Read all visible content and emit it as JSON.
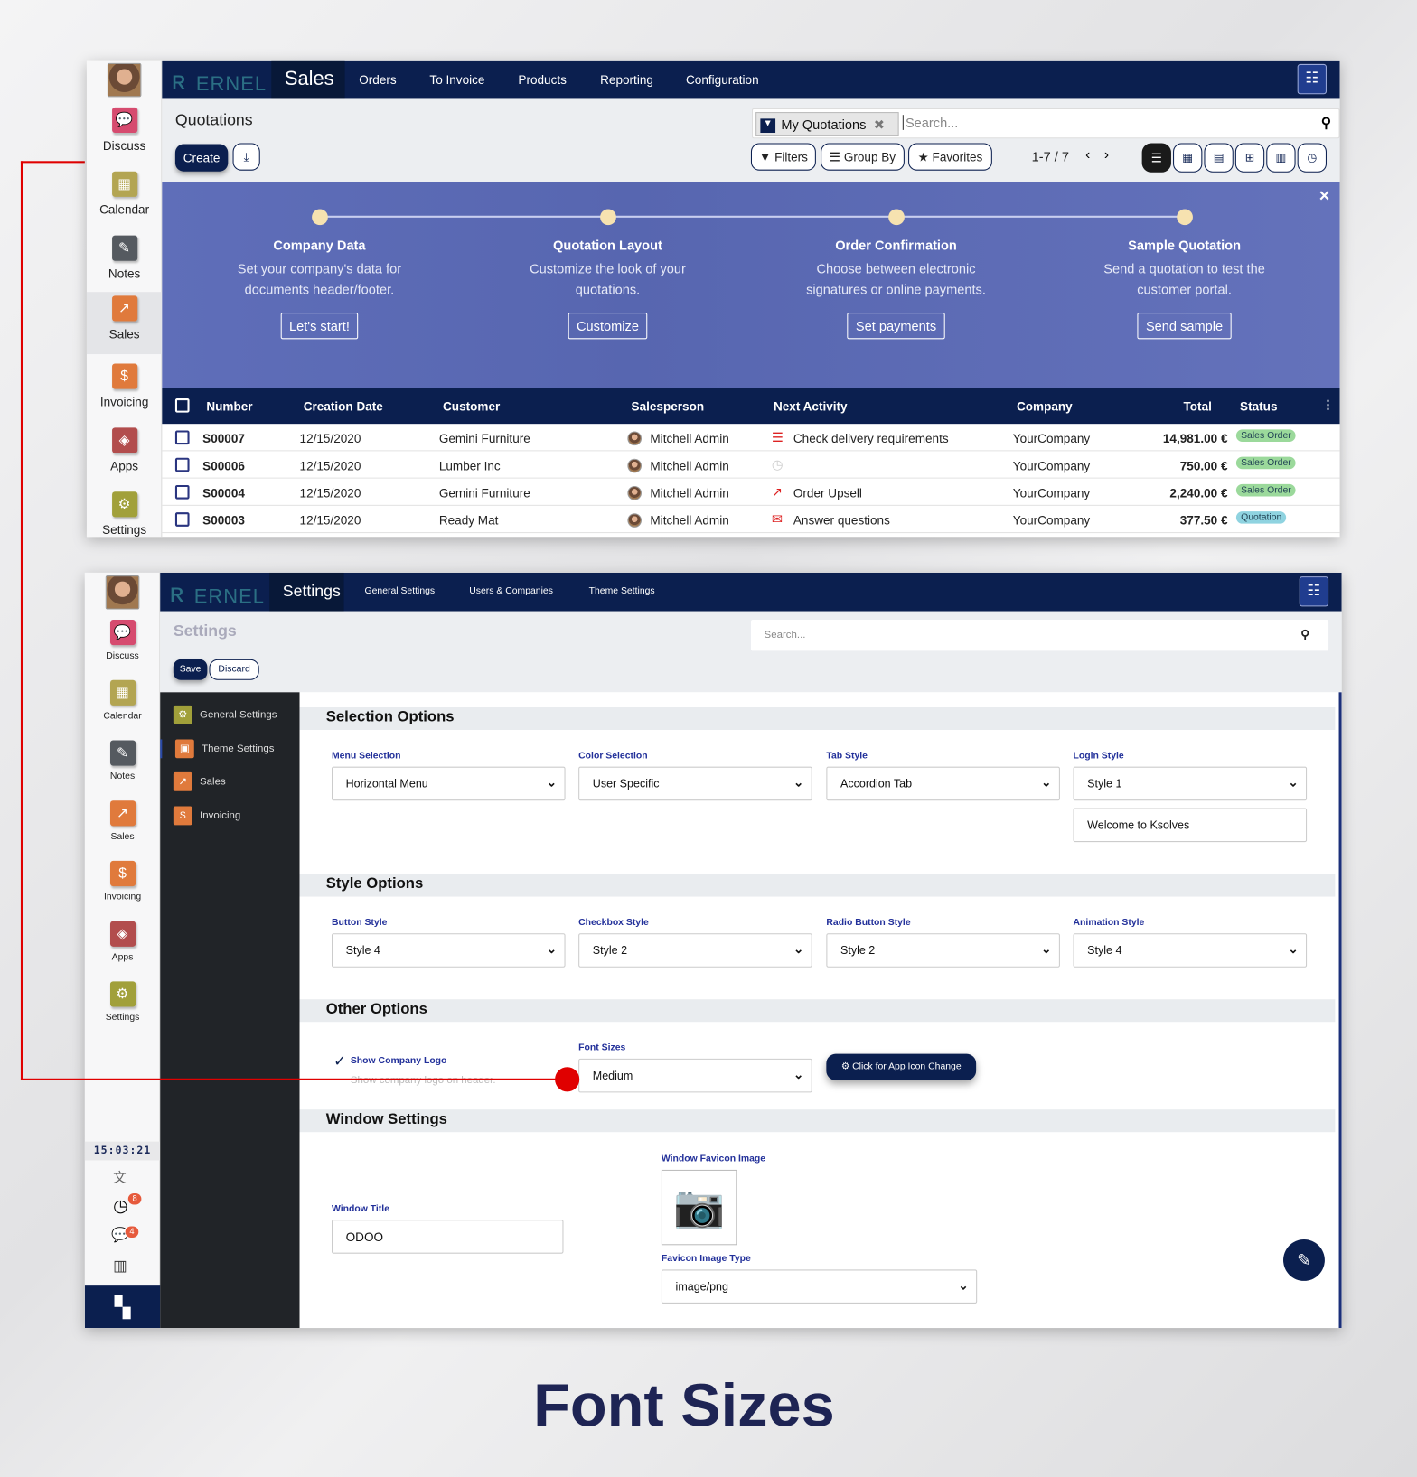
{
  "panel1": {
    "sidebar": [
      {
        "label": "Discuss",
        "icon": "chat-icon",
        "color": "#d64b6f",
        "glyph": "💬"
      },
      {
        "label": "Calendar",
        "icon": "calendar-icon",
        "color": "#b3a552",
        "glyph": "▦"
      },
      {
        "label": "Notes",
        "icon": "notes-icon",
        "color": "#555a60",
        "glyph": "✎"
      },
      {
        "label": "Sales",
        "icon": "sales-chart-icon",
        "color": "#e07a3c",
        "glyph": "↗"
      },
      {
        "label": "Invoicing",
        "icon": "invoice-icon",
        "color": "#e07a3c",
        "glyph": "$"
      },
      {
        "label": "Apps",
        "icon": "apps-icon",
        "color": "#b24d4d",
        "glyph": "◈"
      },
      {
        "label": "Settings",
        "icon": "gear-icon",
        "color": "#a1a03a",
        "glyph": "⚙"
      }
    ],
    "logo": "ERNEL",
    "app_title": "Sales",
    "menu": [
      "Orders",
      "To Invoice",
      "Products",
      "Reporting",
      "Configuration"
    ],
    "page_title": "Quotations",
    "create_label": "Create",
    "search": {
      "facet": "My Quotations",
      "placeholder": "Search..."
    },
    "filters": "Filters",
    "group_by": "Group By",
    "favorites": "Favorites",
    "pager": "1-7 / 7",
    "banner": {
      "steps": [
        {
          "title": "Company Data",
          "text": "Set your company's data for documents header/footer.",
          "button": "Let's start!"
        },
        {
          "title": "Quotation Layout",
          "text": "Customize the look of your quotations.",
          "button": "Customize"
        },
        {
          "title": "Order Confirmation",
          "text": "Choose between electronic signatures or online payments.",
          "button": "Set payments"
        },
        {
          "title": "Sample Quotation",
          "text": "Send a quotation to test the customer portal.",
          "button": "Send sample"
        }
      ]
    },
    "table": {
      "headers": [
        "Number",
        "Creation Date",
        "Customer",
        "Salesperson",
        "Next Activity",
        "Company",
        "Total",
        "Status"
      ],
      "rows": [
        {
          "number": "S00007",
          "date": "12/15/2020",
          "customer": "Gemini Furniture",
          "salesperson": "Mitchell Admin",
          "activity": "Check delivery requirements",
          "activity_icon": "checklist-icon",
          "company": "YourCompany",
          "total": "14,981.00 €",
          "status": "Sales Order"
        },
        {
          "number": "S00006",
          "date": "12/15/2020",
          "customer": "Lumber Inc",
          "salesperson": "Mitchell Admin",
          "activity": "",
          "activity_icon": "clock-icon",
          "company": "YourCompany",
          "total": "750.00 €",
          "status": "Sales Order"
        },
        {
          "number": "S00004",
          "date": "12/15/2020",
          "customer": "Gemini Furniture",
          "salesperson": "Mitchell Admin",
          "activity": "Order Upsell",
          "activity_icon": "upsell-chart-icon",
          "company": "YourCompany",
          "total": "2,240.00 €",
          "status": "Sales Order"
        },
        {
          "number": "S00003",
          "date": "12/15/2020",
          "customer": "Ready Mat",
          "salesperson": "Mitchell Admin",
          "activity": "Answer questions",
          "activity_icon": "email-icon",
          "company": "YourCompany",
          "total": "377.50 €",
          "status": "Quotation"
        }
      ]
    }
  },
  "panel2": {
    "sidebar": [
      {
        "label": "Discuss"
      },
      {
        "label": "Calendar"
      },
      {
        "label": "Notes"
      },
      {
        "label": "Sales"
      },
      {
        "label": "Invoicing"
      },
      {
        "label": "Apps"
      },
      {
        "label": "Settings"
      }
    ],
    "app_title": "Settings",
    "menu": [
      "General Settings",
      "Users & Companies",
      "Theme Settings"
    ],
    "page_title": "Settings",
    "search_placeholder": "Search...",
    "save": "Save",
    "discard": "Discard",
    "settings_menu": [
      "General Settings",
      "Theme Settings",
      "Sales",
      "Invoicing"
    ],
    "clock": "15:03:21",
    "activity_badge": "8",
    "message_badge": "4",
    "sections": {
      "selection": {
        "title": "Selection Options",
        "menu_label": "Menu Selection",
        "menu_value": "Horizontal Menu",
        "color_label": "Color Selection",
        "color_value": "User Specific",
        "tab_label": "Tab Style",
        "tab_value": "Accordion Tab",
        "login_label": "Login Style",
        "login_value": "Style 1",
        "login_text": "Welcome to Ksolves"
      },
      "style": {
        "title": "Style Options",
        "button_label": "Button Style",
        "button_value": "Style 4",
        "checkbox_label": "Checkbox Style",
        "checkbox_value": "Style 2",
        "radio_label": "Radio Button Style",
        "radio_value": "Style 2",
        "animation_label": "Animation Style",
        "animation_value": "Style 4"
      },
      "other": {
        "title": "Other Options",
        "logo_label": "Show Company Logo",
        "logo_help": "Show company logo on header.",
        "logo_checked": true,
        "font_label": "Font Sizes",
        "font_value": "Medium",
        "app_icon_button": "Click for App Icon Change"
      },
      "window": {
        "title": "Window Settings",
        "title_label": "Window Title",
        "title_value": "ODOO",
        "favicon_label": "Window Favicon Image",
        "favicon_type_label": "Favicon Image Type",
        "favicon_type_value": "image/png"
      }
    }
  },
  "caption": "Font Sizes",
  "colors": {
    "navy": "#0b1f4f",
    "banner": "#5c6bb5",
    "highlight": "#e00000",
    "sales_order_badge": "#9bd99b",
    "quotation_badge": "#8fd3e0"
  }
}
